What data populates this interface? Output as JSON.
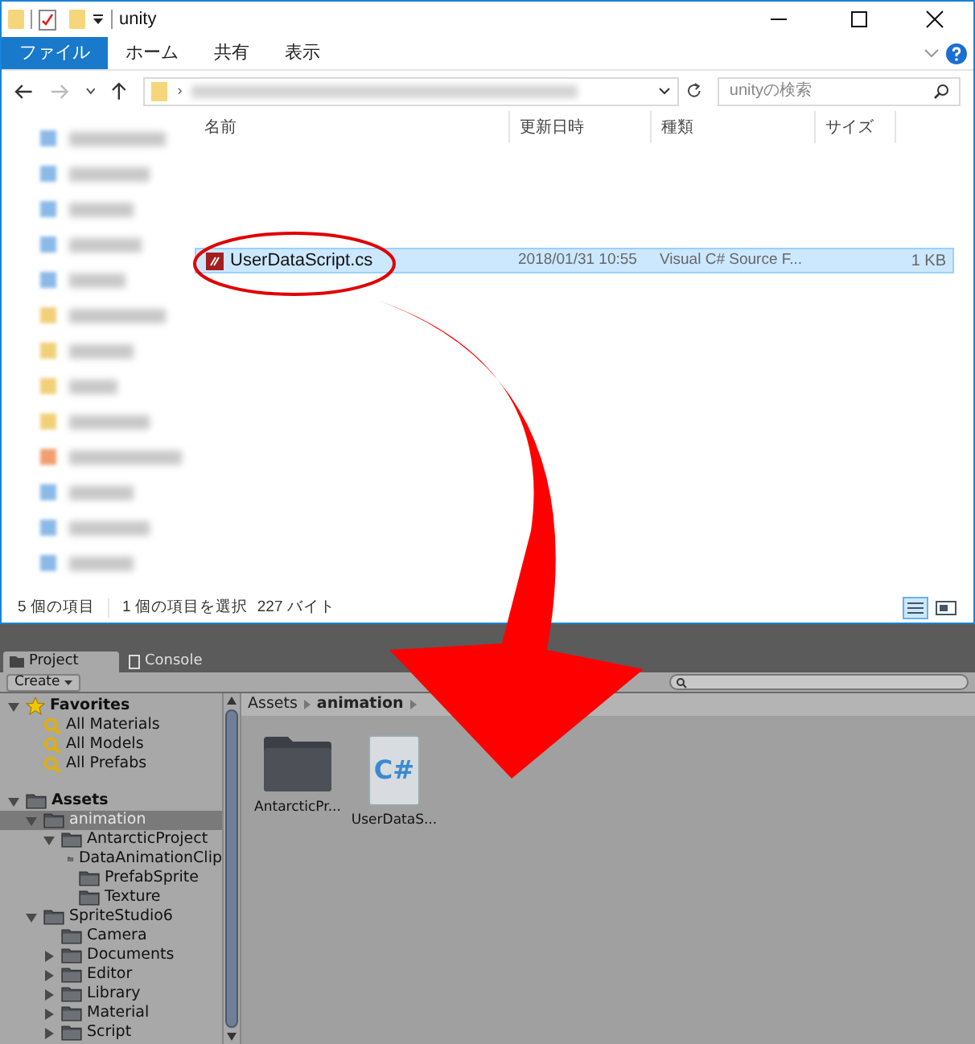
{
  "explorer": {
    "title": "unity",
    "ribbon_tabs": [
      {
        "label": "ファイル",
        "selected": true
      },
      {
        "label": "ホーム",
        "selected": false
      },
      {
        "label": "共有",
        "selected": false
      },
      {
        "label": "表示",
        "selected": false
      }
    ],
    "address_separator": "›",
    "search": {
      "placeholder": "unityの検索"
    },
    "columns": [
      "名前",
      "更新日時",
      "種類",
      "サイズ"
    ],
    "files": [
      {
        "name": "UserDataScript.cs",
        "modified": "2018/01/31 10:55",
        "type": "Visual C# Source F...",
        "size": "1 KB",
        "selected": true
      }
    ],
    "status": [
      "5 個の項目",
      "1 個の項目を選択",
      "227 バイト"
    ]
  },
  "unity": {
    "tabs": [
      {
        "label": "Project",
        "selected": true
      },
      {
        "label": "Console",
        "selected": false
      }
    ],
    "create_button": "Create",
    "tree": [
      {
        "label": "Favorites",
        "kind": "favorites",
        "expanded": true,
        "selected": false,
        "children": [
          {
            "label": "All Materials",
            "kind": "search",
            "selected": false
          },
          {
            "label": "All Models",
            "kind": "search",
            "selected": false
          },
          {
            "label": "All Prefabs",
            "kind": "search",
            "selected": false
          }
        ]
      },
      {
        "label": "Assets",
        "kind": "root",
        "expanded": true,
        "selected": false,
        "children": [
          {
            "label": "animation",
            "kind": "folder",
            "expanded": true,
            "selected": true,
            "children": [
              {
                "label": "AntarcticProject",
                "kind": "folder",
                "expanded": true,
                "selected": false,
                "children": [
                  {
                    "label": "DataAnimationClip",
                    "kind": "folder",
                    "selected": false
                  },
                  {
                    "label": "PrefabSprite",
                    "kind": "folder",
                    "selected": false
                  },
                  {
                    "label": "Texture",
                    "kind": "folder",
                    "selected": false
                  }
                ]
              }
            ]
          },
          {
            "label": "SpriteStudio6",
            "kind": "folder",
            "expanded": true,
            "selected": false,
            "children": [
              {
                "label": "Camera",
                "kind": "folder",
                "selected": false
              },
              {
                "label": "Documents",
                "kind": "folder",
                "expanded": false,
                "selected": false
              },
              {
                "label": "Editor",
                "kind": "folder",
                "expanded": false,
                "selected": false
              },
              {
                "label": "Library",
                "kind": "folder",
                "expanded": false,
                "selected": false
              },
              {
                "label": "Material",
                "kind": "folder",
                "expanded": false,
                "selected": false
              },
              {
                "label": "Script",
                "kind": "folder",
                "expanded": false,
                "selected": false
              }
            ]
          }
        ]
      }
    ],
    "breadcrumb": [
      "Assets",
      "animation"
    ],
    "assets": [
      {
        "name": "AntarcticPr...",
        "kind": "folder"
      },
      {
        "name": "UserDataS...",
        "kind": "script",
        "icon_text": "C#"
      }
    ]
  }
}
